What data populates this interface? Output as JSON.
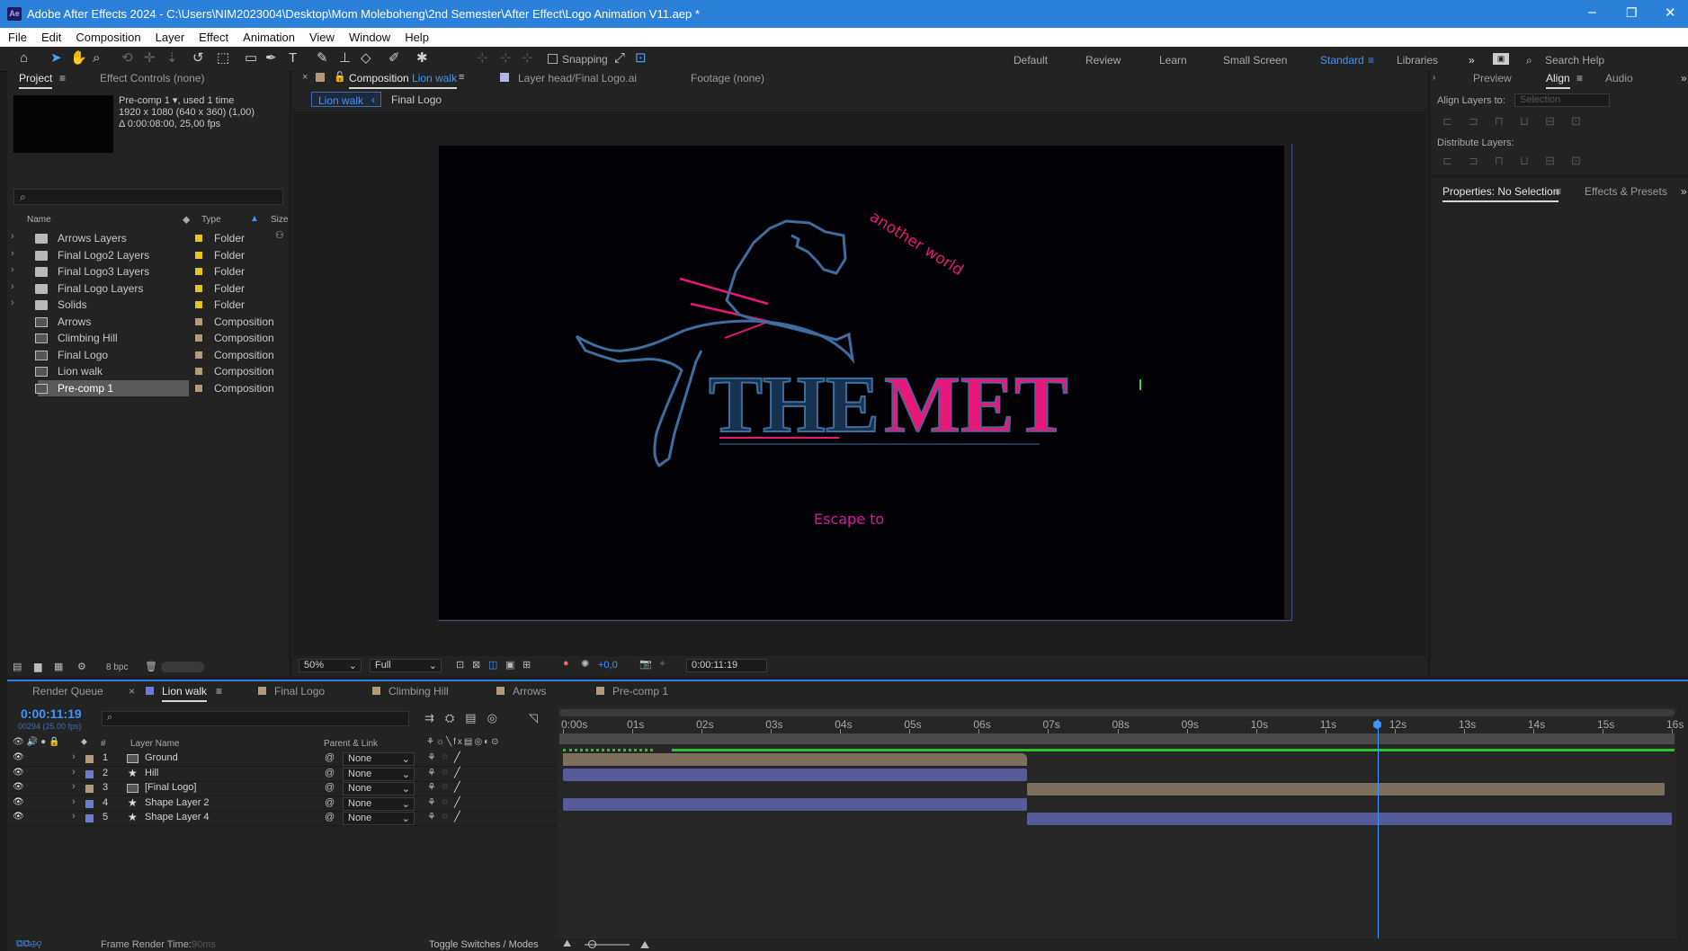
{
  "window": {
    "title": "Adobe After Effects 2024 - C:\\Users\\NIM2023004\\Desktop\\Mom Moleboheng\\2nd Semester\\After Effect\\Logo Animation V11.aep *",
    "app_icon": "Ae",
    "controls": [
      "–",
      "❐",
      "✕"
    ]
  },
  "menu": [
    "File",
    "Edit",
    "Composition",
    "Layer",
    "Effect",
    "Animation",
    "View",
    "Window",
    "Help"
  ],
  "toolbar": {
    "snapping_label": "Snapping",
    "workspaces": [
      "Default",
      "Review",
      "Learn",
      "Small Screen",
      "Standard",
      "Libraries"
    ],
    "active_workspace": "Standard",
    "search_placeholder": "Search Help"
  },
  "project_panel": {
    "tab_project": "Project",
    "tab_effect_controls": "Effect Controls (none)",
    "selected_name": "Pre-comp 1",
    "selected_usage": ", used 1 time",
    "selected_dims": "1920 x 1080  (640 x 360) (1,00)",
    "selected_duration": "Δ 0:00:08:00, 25,00 fps",
    "col_name": "Name",
    "col_type": "Type",
    "col_size": "Size",
    "items": [
      {
        "name": "Arrows Layers",
        "type": "Folder",
        "kind": "folder"
      },
      {
        "name": "Final Logo2 Layers",
        "type": "Folder",
        "kind": "folder"
      },
      {
        "name": "Final Logo3 Layers",
        "type": "Folder",
        "kind": "folder"
      },
      {
        "name": "Final Logo Layers",
        "type": "Folder",
        "kind": "folder"
      },
      {
        "name": "Solids",
        "type": "Folder",
        "kind": "folder"
      },
      {
        "name": "Arrows",
        "type": "Composition",
        "kind": "comp"
      },
      {
        "name": "Climbing Hill",
        "type": "Composition",
        "kind": "comp"
      },
      {
        "name": "Final Logo",
        "type": "Composition",
        "kind": "comp"
      },
      {
        "name": "Lion walk",
        "type": "Composition",
        "kind": "comp"
      },
      {
        "name": "Pre-comp 1",
        "type": "Composition",
        "kind": "comp",
        "selected": true
      }
    ],
    "bpc": "8 bpc"
  },
  "comp_panel": {
    "tab_prefix": "Composition",
    "tab_name": "Lion walk",
    "layer_tab": "Layer  head/Final Logo.ai",
    "footage_tab": "Footage  (none)",
    "breadcrumb_active": "Lion walk",
    "breadcrumb_next": "Final Logo",
    "art": {
      "tagline_top": "another world",
      "title_a": "THE",
      "title_b": "MET",
      "tagline_bottom": "Escape to"
    },
    "zoom": "50%",
    "resolution": "Full",
    "exposure": "+0,0",
    "timecode": "0:00:11:19"
  },
  "right_panel": {
    "tab_preview": "Preview",
    "tab_align": "Align",
    "tab_audio": "Audio",
    "align_layers_to": "Align Layers to:",
    "align_target": "Selection",
    "distribute_layers": "Distribute Layers:",
    "tab_properties": "Properties: No Selection",
    "tab_effects": "Effects & Presets"
  },
  "timeline": {
    "tabs": [
      "Render Queue",
      "Lion walk",
      "Final Logo",
      "Climbing Hill",
      "Arrows",
      "Pre-comp 1"
    ],
    "active_tab": "Lion walk",
    "current_time": "0:00:11:19",
    "frame_info": "00294 (25.00 fps)",
    "col_layer_name": "Layer Name",
    "col_parent": "Parent & Link",
    "col_num": "#",
    "ruler": [
      "0:00s",
      "01s",
      "02s",
      "03s",
      "04s",
      "05s",
      "06s",
      "07s",
      "08s",
      "09s",
      "10s",
      "11s",
      "12s",
      "13s",
      "14s",
      "15s",
      "16s"
    ],
    "playhead_seconds": 11.76,
    "duration_seconds": 16,
    "layers": [
      {
        "num": "1",
        "name": "Ground",
        "label": "#b39a78",
        "kind": "comp",
        "parent": "None",
        "start": 0,
        "end": 6.7,
        "bar": "#7c6f5e"
      },
      {
        "num": "2",
        "name": "Hill",
        "label": "#6e7bd1",
        "kind": "shape",
        "parent": "None",
        "start": 0,
        "end": 6.7,
        "bar": "#555c99"
      },
      {
        "num": "3",
        "name": "[Final Logo]",
        "label": "#b39a78",
        "kind": "comp",
        "parent": "None",
        "start": 6.7,
        "end": 15.9,
        "bar": "#7c6f5e"
      },
      {
        "num": "4",
        "name": "Shape Layer 2",
        "label": "#6e7bd1",
        "kind": "shape",
        "parent": "None",
        "start": 0,
        "end": 6.7,
        "bar": "#555c99"
      },
      {
        "num": "5",
        "name": "Shape Layer 4",
        "label": "#6e7bd1",
        "kind": "shape",
        "parent": "None",
        "start": 6.7,
        "end": 16,
        "bar": "#555c99"
      }
    ],
    "frame_render_time_label": "Frame Render Time:",
    "frame_render_time": "90ms",
    "toggle_label": "Toggle Switches / Modes"
  },
  "colors": {
    "accent_blue": "#2b80d9",
    "pink": "#e6197a",
    "steel_blue": "#3f6d9e",
    "magenta": "#d917a4"
  }
}
